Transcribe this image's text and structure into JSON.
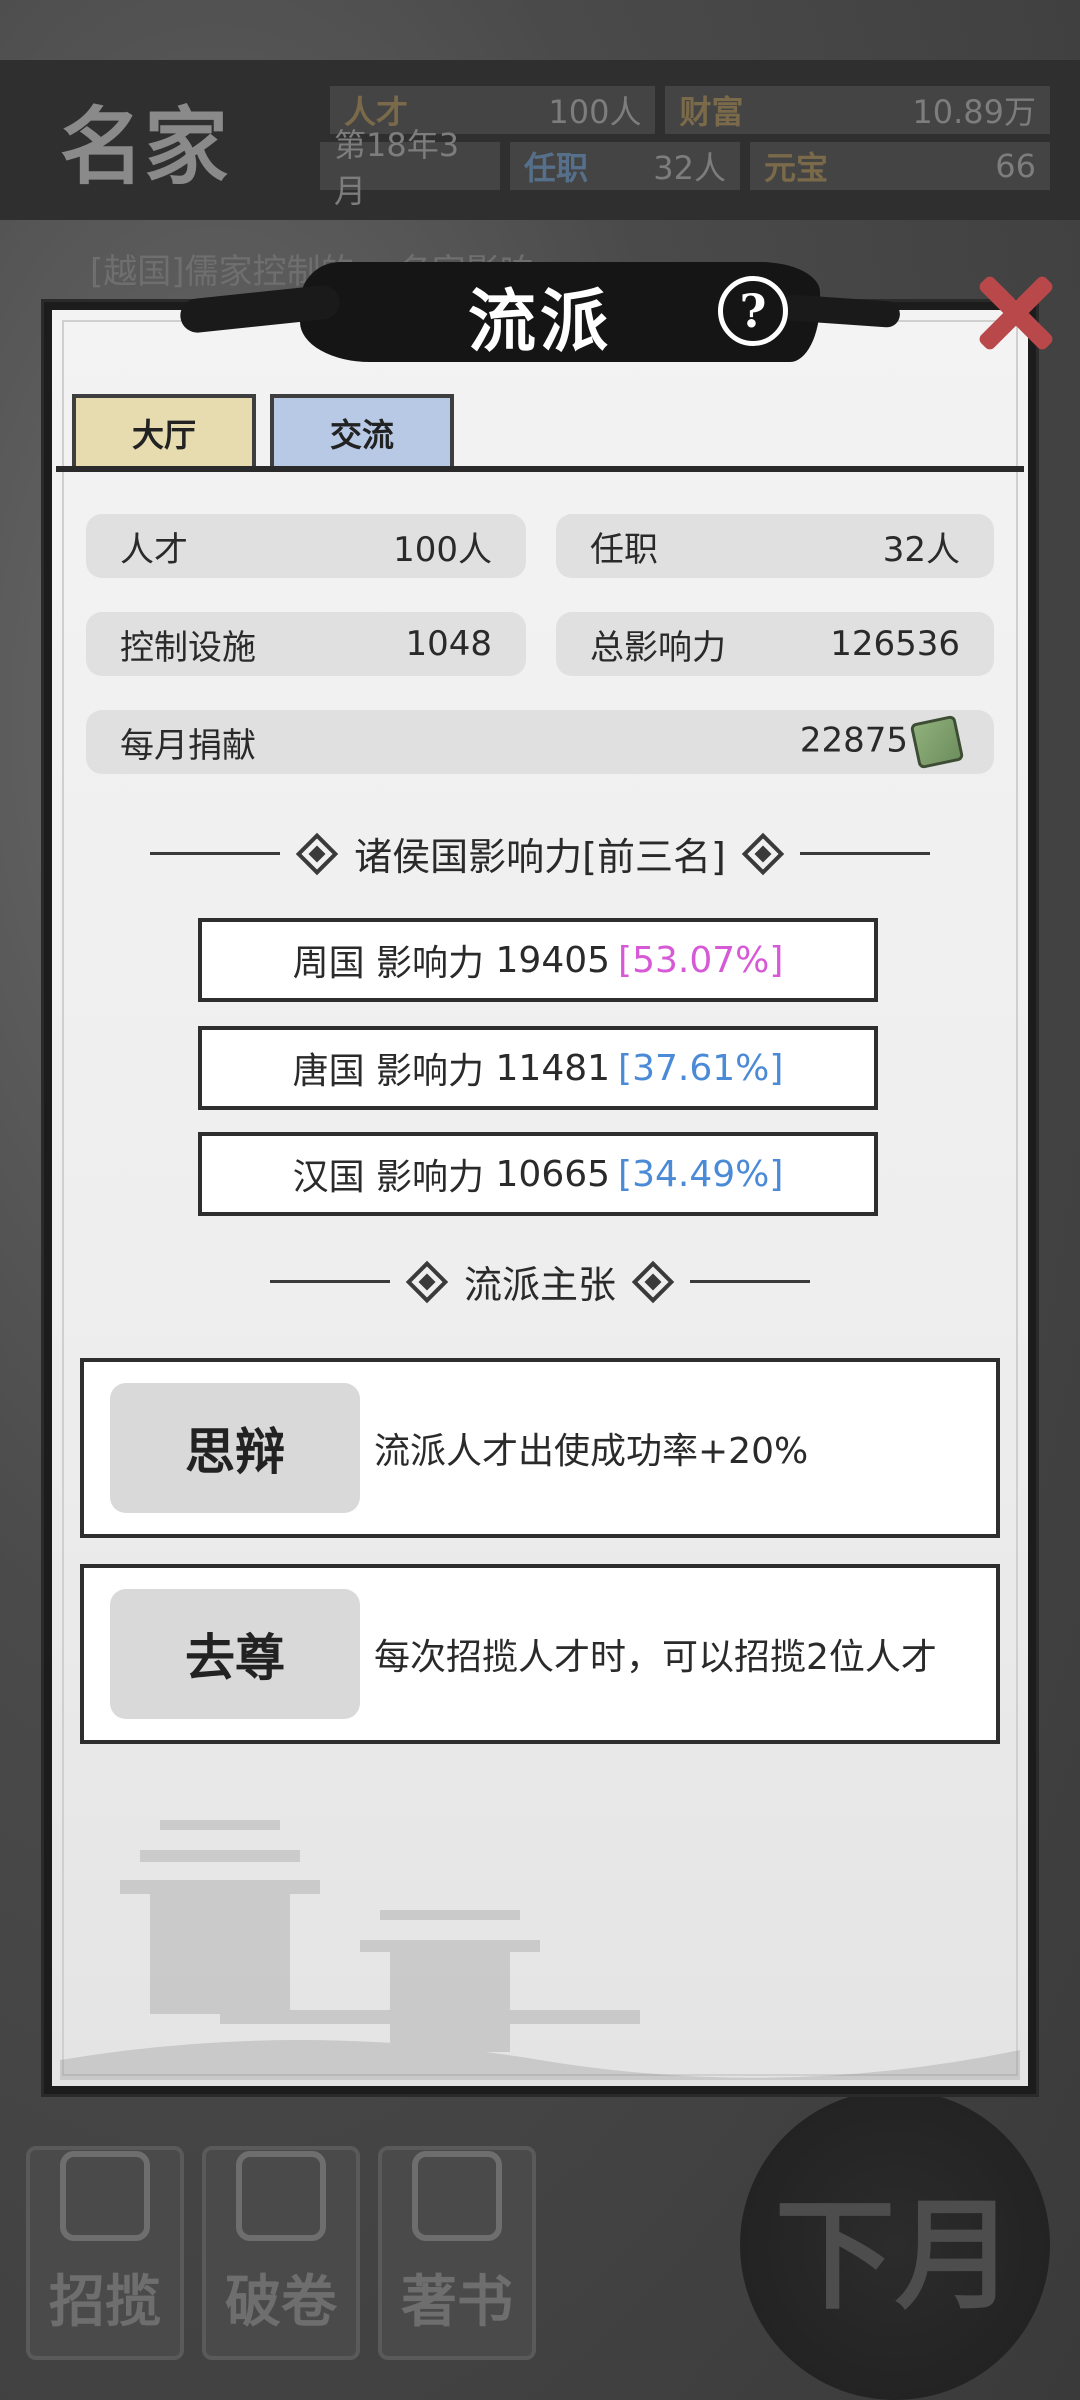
{
  "background": {
    "game_title": "名家",
    "stats_row1": [
      {
        "label": "人才",
        "value": "100人"
      },
      {
        "label": "财富",
        "value": "10.89万"
      }
    ],
    "stats_row2": [
      {
        "label": "",
        "value": "第18年3月"
      },
      {
        "label": "任职",
        "value": "32人"
      },
      {
        "label": "元宝",
        "value": "66"
      }
    ],
    "notice": "[越国]儒家控制的... 名家影响",
    "nav": [
      {
        "label": "招揽",
        "icon": "recruit-icon"
      },
      {
        "label": "破卷",
        "icon": "scroll-icon"
      },
      {
        "label": "著书",
        "icon": "write-book-icon"
      }
    ],
    "next_month": "下月"
  },
  "panel": {
    "title": "流派",
    "help_glyph": "?",
    "tabs": [
      {
        "label": "大厅",
        "active": false,
        "color": "#e6dcb0"
      },
      {
        "label": "交流",
        "active": true,
        "color": "#b8c9e6"
      }
    ],
    "stats": {
      "talent": {
        "label": "人才",
        "value": "100人"
      },
      "office": {
        "label": "任职",
        "value": "32人"
      },
      "facilities": {
        "label": "控制设施",
        "value": "1048"
      },
      "total_influence": {
        "label": "总影响力",
        "value": "126536"
      },
      "monthly_donation": {
        "label": "每月捐献",
        "value": "22875"
      }
    },
    "influence_section_title": "诸侯国影响力[前三名]",
    "influence_rows": [
      {
        "state": "周国",
        "label": "影响力",
        "value": "19405",
        "percent": "[53.07%]",
        "percent_color": "#d65ad6"
      },
      {
        "state": "唐国",
        "label": "影响力",
        "value": "11481",
        "percent": "[37.61%]",
        "percent_color": "#4a8ad6"
      },
      {
        "state": "汉国",
        "label": "影响力",
        "value": "10665",
        "percent": "[34.49%]",
        "percent_color": "#4a8ad6"
      }
    ],
    "doctrine_section_title": "流派主张",
    "doctrines": [
      {
        "name": "思辩",
        "desc": "流派人才出使成功率+20%"
      },
      {
        "name": "去尊",
        "desc": "每次招揽人才时，可以招揽2位人才"
      }
    ]
  },
  "colors": {
    "panel_bg": "#f0f0f0",
    "ink": "#1c1c1c",
    "close_red": "#b8484a",
    "pink_percent": "#d65ad6",
    "blue_percent": "#4a8ad6"
  }
}
